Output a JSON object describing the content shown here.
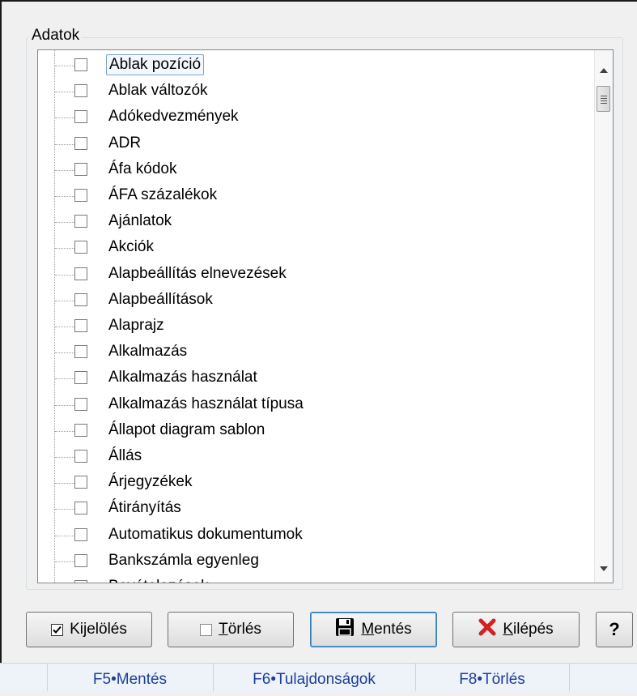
{
  "group": {
    "title": "Adatok"
  },
  "tree_items": [
    {
      "label": "Ablak pozíció",
      "checked": false
    },
    {
      "label": "Ablak változók",
      "checked": false
    },
    {
      "label": "Adókedvezmények",
      "checked": false
    },
    {
      "label": "ADR",
      "checked": false
    },
    {
      "label": "Áfa kódok",
      "checked": false
    },
    {
      "label": "ÁFA százalékok",
      "checked": false
    },
    {
      "label": "Ajánlatok",
      "checked": false
    },
    {
      "label": "Akciók",
      "checked": false
    },
    {
      "label": "Alapbeállítás elnevezések",
      "checked": false
    },
    {
      "label": "Alapbeállítások",
      "checked": false
    },
    {
      "label": "Alaprajz",
      "checked": false
    },
    {
      "label": "Alkalmazás",
      "checked": false
    },
    {
      "label": "Alkalmazás használat",
      "checked": false
    },
    {
      "label": "Alkalmazás használat típusa",
      "checked": false
    },
    {
      "label": "Állapot diagram sablon",
      "checked": false
    },
    {
      "label": "Állás",
      "checked": false
    },
    {
      "label": "Árjegyzékek",
      "checked": false
    },
    {
      "label": "Átirányítás",
      "checked": false
    },
    {
      "label": "Automatikus dokumentumok",
      "checked": false
    },
    {
      "label": "Bankszámla egyenleg",
      "checked": false
    },
    {
      "label": "Bevételezések",
      "checked": false
    }
  ],
  "buttons": {
    "select_all": "Kijelölés",
    "clear_underline": "T",
    "clear_rest": "örlés",
    "save_underline": "M",
    "save_rest": "entés",
    "exit_underline": "K",
    "exit_rest": "ilépés",
    "help": "?"
  },
  "statusbar": {
    "f5": "F5•Mentés",
    "f6": "F6•Tulajdonságok",
    "f8": "F8•Törlés"
  },
  "colors": {
    "status_text": "#1d3e9a",
    "exit_icon": "#d42020",
    "save_icon": "#000000"
  }
}
